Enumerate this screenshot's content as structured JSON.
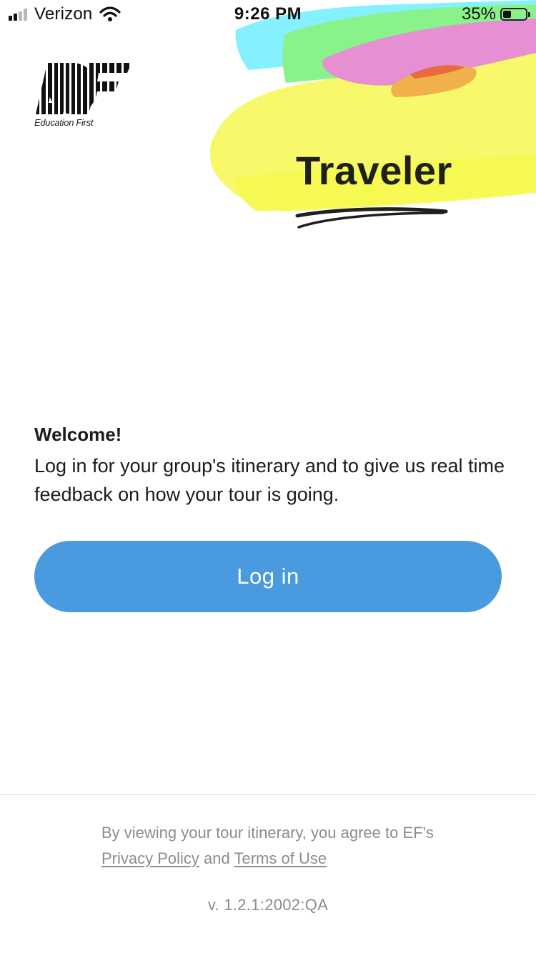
{
  "status_bar": {
    "carrier": "Verizon",
    "time": "9:26 PM",
    "battery_percent": "35%",
    "battery_level": 0.35,
    "signal_bars_active": 2,
    "signal_bars_total": 4,
    "icons": [
      "signal-icon",
      "wifi-icon",
      "battery-icon"
    ]
  },
  "branding": {
    "logo_caption": "Education First",
    "app_title": "Traveler"
  },
  "welcome": {
    "heading": "Welcome!",
    "body": "Log in for your group's itinerary and to give us real time feedback on how your tour is going."
  },
  "login": {
    "button_label": "Log in"
  },
  "footer": {
    "legal_prefix": "By viewing your tour itinerary, you agree to EF's",
    "privacy_link": "Privacy Policy",
    "conjunction": "and",
    "terms_link": "Terms of Use",
    "version": "v. 1.2.1:2002:QA"
  },
  "colors": {
    "primary_button": "#4a9ae0",
    "text": "#1c1c1c",
    "muted_text": "#8c8c8c",
    "paint_yellow": "#f7f96a",
    "paint_cyan": "#7ef0ff",
    "paint_green": "#8af28a",
    "paint_pink": "#e68fd3",
    "paint_orange": "#f0b04a"
  }
}
